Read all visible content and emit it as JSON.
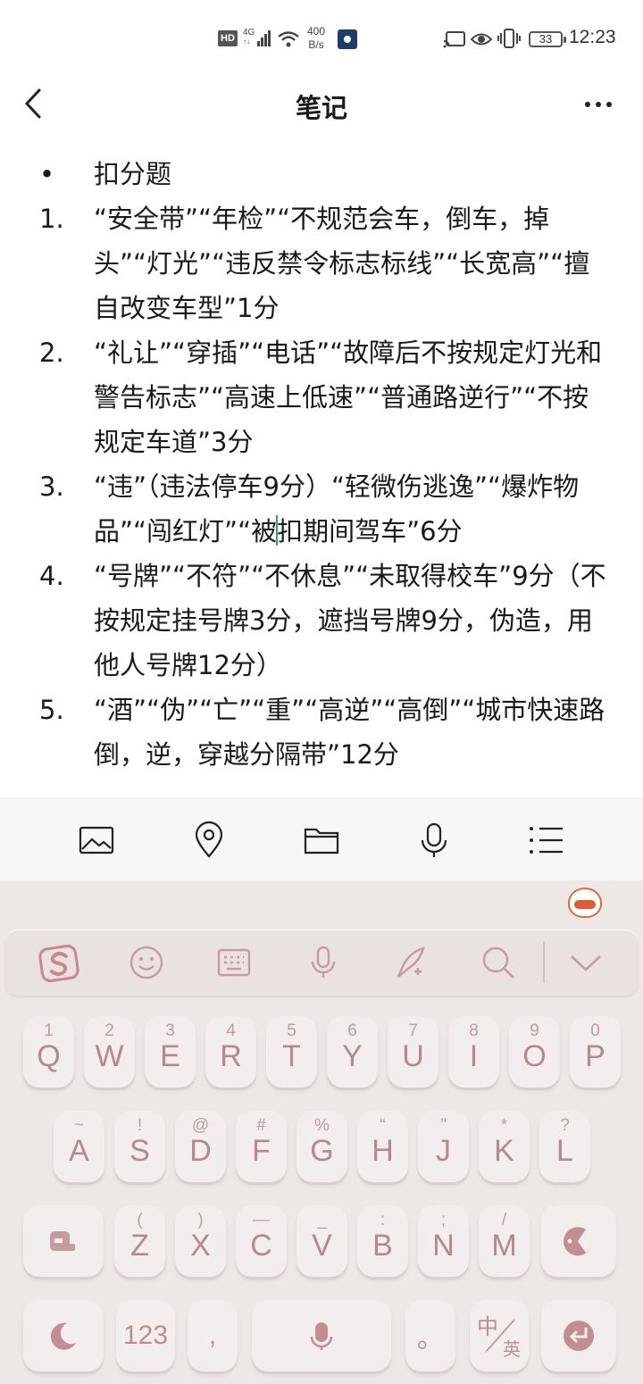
{
  "status_bar": {
    "hd": "HD",
    "network": "4G",
    "network_sub": "↑↓",
    "speed_value": "400",
    "speed_unit": "B/s",
    "battery": "33",
    "time": "12:23"
  },
  "header": {
    "title": "笔记",
    "more": "···"
  },
  "note": {
    "items": [
      {
        "marker": "•",
        "text": "扣分题"
      },
      {
        "marker": "1.",
        "text": "“安全带”“年检”“不规范会车，倒车，掉头”“灯光”“违反禁令标志标线”“长宽高”“擅自改变车型”1分"
      },
      {
        "marker": "2.",
        "text": "“礼让”“穿插”“电话”“故障后不按规定灯光和警告标志”“高速上低速”“普通路逆行”“不按规定车道”3分"
      },
      {
        "marker": "3.",
        "text_before_cursor": "“违”（违法停车9分）“轻微伤逃逸”“爆炸物品”“闯红灯”“被",
        "text_after_cursor": "扣期间驾车”6分"
      },
      {
        "marker": "4.",
        "text": "“号牌”“不符”“不休息”“未取得校车”9分（不按规定挂号牌3分，遮挡号牌9分，伪造，用他人号牌12分）"
      },
      {
        "marker": "5.",
        "text": "“酒”“伪”“亡”“重”“高逆”“高倒”“城市快速路倒，逆，穿越分隔带”12分"
      }
    ]
  },
  "toolbar": {
    "icons": [
      "image-icon",
      "location-icon",
      "folder-icon",
      "microphone-icon",
      "checklist-icon"
    ]
  },
  "keyboard": {
    "accent_color": "#b98e91",
    "candidate_bar_icons": [
      "sogou-logo-icon",
      "emoji-icon",
      "keyboard-icon",
      "voice-icon",
      "handwriting-icon",
      "search-icon",
      "collapse-icon"
    ],
    "row1": [
      {
        "main": "Q",
        "sub": "1"
      },
      {
        "main": "W",
        "sub": "2"
      },
      {
        "main": "E",
        "sub": "3"
      },
      {
        "main": "R",
        "sub": "4"
      },
      {
        "main": "T",
        "sub": "5"
      },
      {
        "main": "Y",
        "sub": "6"
      },
      {
        "main": "U",
        "sub": "7"
      },
      {
        "main": "I",
        "sub": "8"
      },
      {
        "main": "O",
        "sub": "9"
      },
      {
        "main": "P",
        "sub": "0"
      }
    ],
    "row2": [
      {
        "main": "A",
        "sub": "~"
      },
      {
        "main": "S",
        "sub": "!"
      },
      {
        "main": "D",
        "sub": "@"
      },
      {
        "main": "F",
        "sub": "#"
      },
      {
        "main": "G",
        "sub": "%"
      },
      {
        "main": "H",
        "sub": "“"
      },
      {
        "main": "J",
        "sub": "”"
      },
      {
        "main": "K",
        "sub": "*"
      },
      {
        "main": "L",
        "sub": "?"
      }
    ],
    "row3": [
      {
        "main": "Z",
        "sub": "("
      },
      {
        "main": "X",
        "sub": ")"
      },
      {
        "main": "C",
        "sub": "—"
      },
      {
        "main": "V",
        "sub": "_"
      },
      {
        "main": "B",
        "sub": ":"
      },
      {
        "main": "N",
        "sub": ";"
      },
      {
        "main": "M",
        "sub": "/"
      }
    ],
    "numbers_key": "123",
    "comma_key": ",",
    "period_key": "。",
    "lang_key_top": "中",
    "lang_key_bottom": "英"
  }
}
